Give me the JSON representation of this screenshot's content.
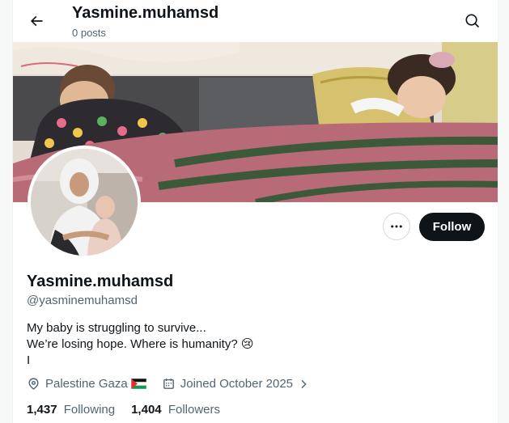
{
  "header": {
    "title": "Yasmine.muhamsd",
    "subtitle": "0 posts",
    "back_icon": "arrow-left-icon",
    "search_icon": "search-icon"
  },
  "profile": {
    "name": "Yasmine.muhamsd",
    "handle": "@yasminemuhamsd",
    "bio": [
      "My baby is struggling to survive...",
      "We’re losing hope. Where is humanity? 😢",
      "I"
    ],
    "location": "Palestine Gaza",
    "location_flag": "palestine-flag",
    "joined": "Joined October 2025",
    "following_count": "1,437",
    "following_label": "Following",
    "followers_count": "1,404",
    "followers_label": "Followers"
  },
  "actions": {
    "follow_label": "Follow",
    "more_icon": "more-dots-icon"
  },
  "colors": {
    "text_primary": "#0f1419",
    "text_secondary": "#536471",
    "follow_button_bg": "#0f1419"
  }
}
